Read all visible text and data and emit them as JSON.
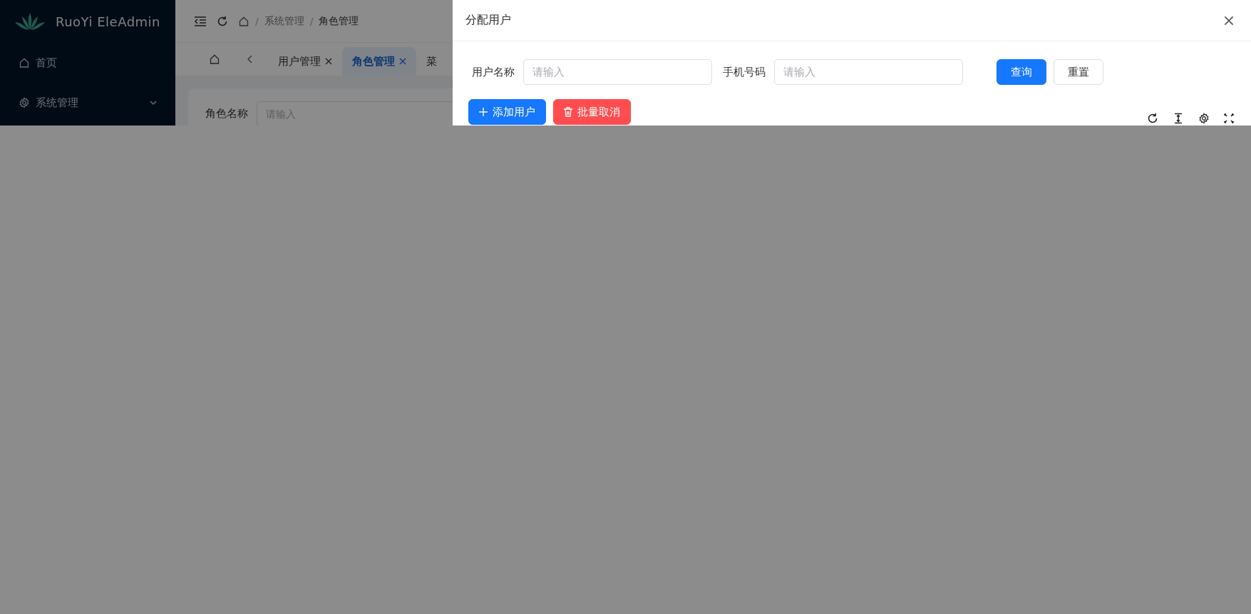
{
  "sidebar": {
    "logo_text": "RuoYi EleAdmin",
    "items": [
      {
        "label": "首页",
        "kind": "link"
      },
      {
        "label": "系统管理",
        "kind": "submenu"
      }
    ]
  },
  "header": {
    "breadcrumb": [
      "系统管理",
      "角色管理"
    ],
    "separators": [
      "/",
      "/"
    ]
  },
  "tabs": [
    {
      "label": "用户管理",
      "selected": false,
      "closable": true
    },
    {
      "label": "角色管理",
      "selected": true,
      "closable": true
    },
    {
      "label": "菜",
      "selected": false,
      "closable": false
    }
  ],
  "search_form": {
    "fields": [
      {
        "label": "角色名称",
        "placeholder": "请输入"
      }
    ]
  },
  "drawer": {
    "title": "分配用户",
    "fields": [
      {
        "label": "用户名称",
        "placeholder": "请输入"
      },
      {
        "label": "手机号码",
        "placeholder": "请输入"
      }
    ],
    "form_buttons": [
      {
        "label": "查询",
        "kind": "primary"
      },
      {
        "label": "重置",
        "kind": "default"
      }
    ],
    "actions": [
      {
        "label": "添加用户",
        "kind": "add"
      },
      {
        "label": "批量取消",
        "kind": "delete"
      }
    ]
  }
}
